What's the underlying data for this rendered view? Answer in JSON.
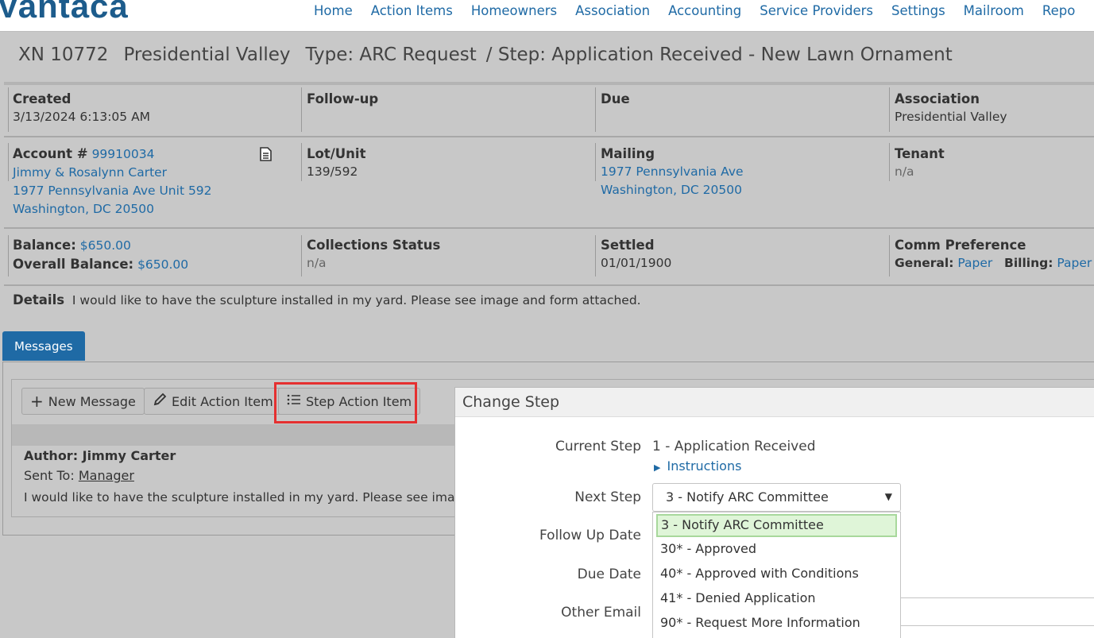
{
  "logo": {
    "text": "Vantaca"
  },
  "nav": [
    "Home",
    "Action Items",
    "Homeowners",
    "Association",
    "Accounting",
    "Service Providers",
    "Settings",
    "Mailroom",
    "Repo"
  ],
  "title": {
    "id": "XN 10772",
    "association": "Presidential Valley",
    "type": "Type: ARC Request",
    "step": "/ Step: Application Received - New Lawn Ornament"
  },
  "info": {
    "created_label": "Created",
    "created_value": "3/13/2024 6:13:05 AM",
    "followup_label": "Follow-up",
    "due_label": "Due",
    "association_label": "Association",
    "association_value": "Presidential Valley",
    "account_label": "Account #",
    "account_value": "99910034",
    "owner_name": "Jimmy & Rosalynn Carter",
    "owner_address1": "1977 Pennsylvania Ave Unit 592",
    "owner_address2": "Washington, DC 20500",
    "lot_label": "Lot/Unit",
    "lot_value": "139/592",
    "mailing_label": "Mailing",
    "mailing_address1": "1977 Pennsylvania Ave",
    "mailing_address2": "Washington, DC 20500",
    "tenant_label": "Tenant",
    "tenant_value": "n/a",
    "balance_label": "Balance:",
    "balance_value": "$650.00",
    "overall_label": "Overall Balance:",
    "overall_value": "$650.00",
    "collections_label": "Collections Status",
    "collections_value": "n/a",
    "settled_label": "Settled",
    "settled_value": "01/01/1900",
    "comm_label": "Comm Preference",
    "general_label": "General:",
    "general_value": "Paper",
    "billing_label": "Billing:",
    "billing_value": "Paper",
    "details_label": "Details",
    "details_value": "I would like to have the sculpture installed in my yard. Please see image and form attached."
  },
  "tabs": {
    "messages": "Messages"
  },
  "toolbar": {
    "new_message": "New Message",
    "edit_action_item": "Edit Action Item",
    "step_action_item": "Step Action Item"
  },
  "message": {
    "author": "Author: Jimmy Carter",
    "sent_to_label": "Sent To:",
    "sent_to_value": "Manager",
    "body": "I would like to have the sculpture installed in my yard. Please see image"
  },
  "modal": {
    "title": "Change Step",
    "current_step_label": "Current Step",
    "current_step_value": "1 - Application Received",
    "instructions": "Instructions",
    "next_step_label": "Next Step",
    "next_step_value": "3 - Notify ARC Committee",
    "follow_up_label": "Follow Up Date",
    "due_date_label": "Due Date",
    "other_email_label": "Other Email",
    "options": [
      "3 - Notify ARC Committee",
      "30* - Approved",
      "40* - Approved with Conditions",
      "41* - Denied Application",
      "90* - Request More Information"
    ]
  }
}
